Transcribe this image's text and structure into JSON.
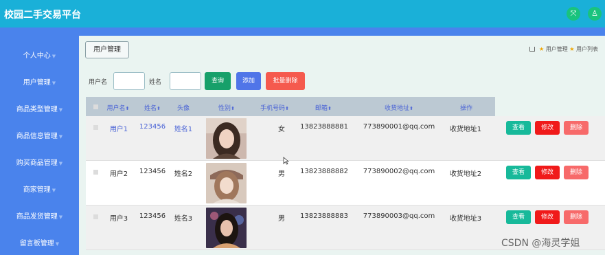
{
  "app": {
    "title": "校园二手交易平台"
  },
  "top_icons": [
    {
      "name": "fullscreen-icon",
      "glyph": "⤧"
    },
    {
      "name": "user-icon",
      "glyph": "♙"
    }
  ],
  "sidebar": {
    "items": [
      {
        "label": "个人中心"
      },
      {
        "label": "用户管理"
      },
      {
        "label": "商品类型管理"
      },
      {
        "label": "商品信息管理"
      },
      {
        "label": "购买商品管理"
      },
      {
        "label": "商家管理"
      },
      {
        "label": "商品发货管理"
      },
      {
        "label": "留言板管理"
      }
    ]
  },
  "tab": {
    "label": "用户管理"
  },
  "breadcrumb": {
    "items": [
      "用户管理",
      "用户列表"
    ]
  },
  "search": {
    "username_label": "用户名",
    "name_label": "姓名",
    "query_label": "查询",
    "add_label": "添加",
    "batch_delete_label": "批量删除"
  },
  "table": {
    "headers": [
      "用户名",
      "姓名",
      "头像",
      "性别",
      "手机号码",
      "邮箱",
      "收货地址",
      "操作"
    ],
    "rows": [
      {
        "username": "用户1",
        "name": "123456",
        "name2": "姓名1",
        "gender": "女",
        "phone": "13823888881",
        "email": "773890001@qq.com",
        "address": "收货地址1"
      },
      {
        "username": "用户2",
        "name": "123456",
        "name2": "姓名2",
        "gender": "男",
        "phone": "13823888882",
        "email": "773890002@qq.com",
        "address": "收货地址2"
      },
      {
        "username": "用户3",
        "name": "123456",
        "name2": "姓名3",
        "gender": "男",
        "phone": "13823888883",
        "email": "773890003@qq.com",
        "address": "收货地址3"
      }
    ],
    "actions": {
      "view": "查看",
      "edit": "修改",
      "delete": "删除"
    }
  },
  "watermark": "CSDN @海灵学姐",
  "colors": {
    "topbar": "#1ab0d8",
    "sidebar": "#4a83ec",
    "content_bg": "#eaf4f1",
    "query": "#17a06a",
    "add": "#5075e8",
    "batch_delete": "#f55a4e",
    "view": "#17b99a",
    "edit": "#f01a1a",
    "delete": "#f76a6a"
  }
}
